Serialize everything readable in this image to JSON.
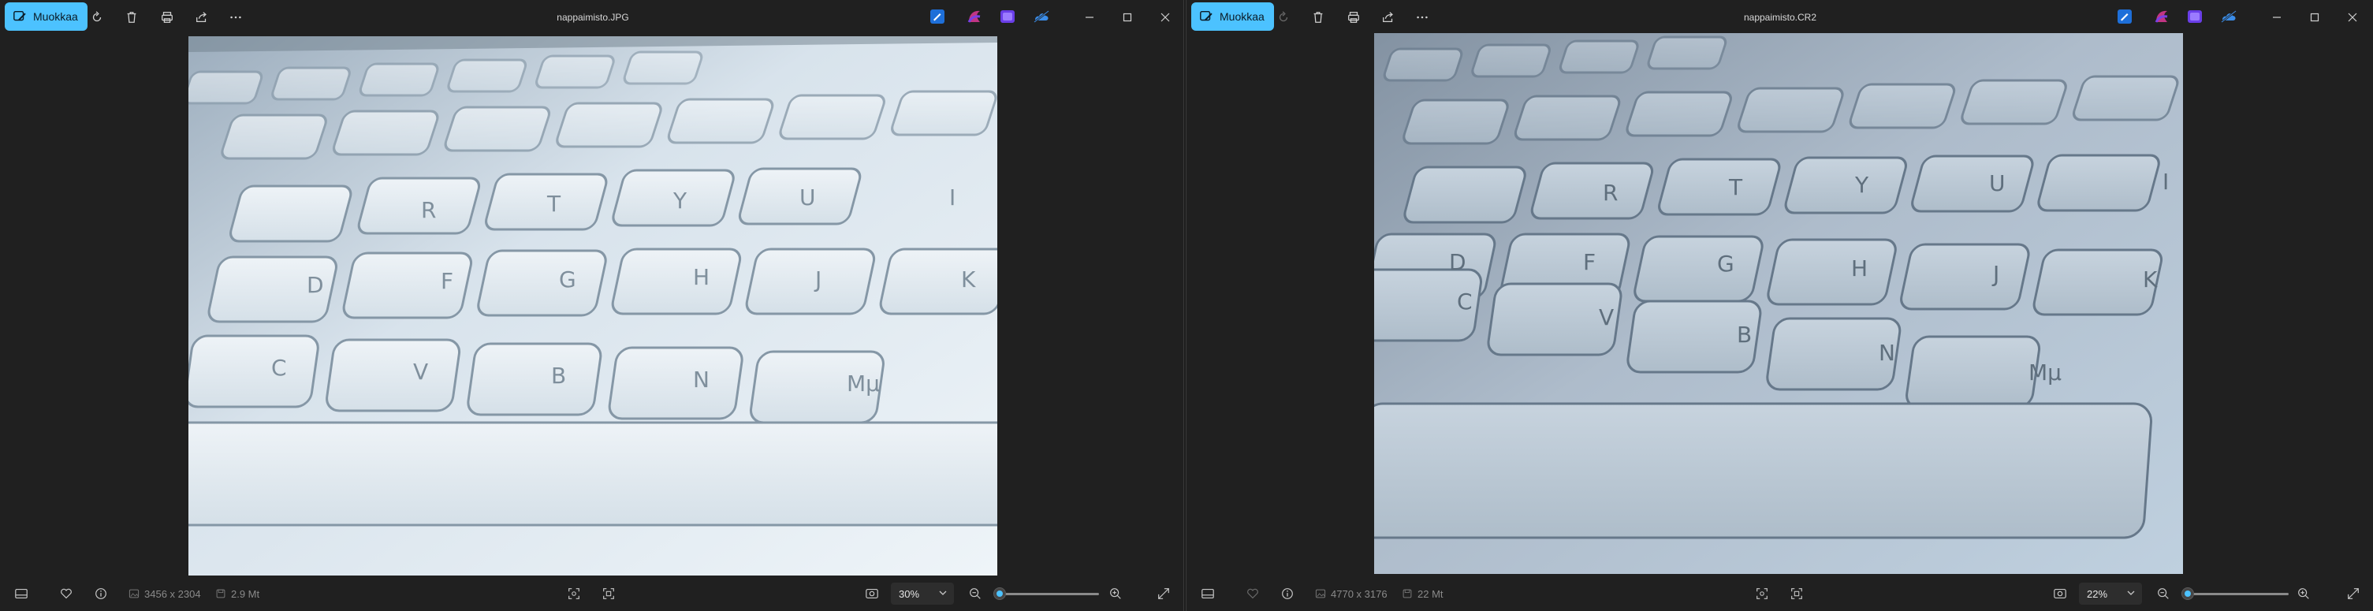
{
  "accent_color": "#4cc2ff",
  "windows": [
    {
      "edit_label": "Muokkaa",
      "filename": "nappaimisto.JPG",
      "dimensions": "3456 x 2304",
      "file_size": "2.9 Mt",
      "zoom": "30%",
      "zoom_fraction": 0.03
    },
    {
      "edit_label": "Muokkaa",
      "filename": "nappaimisto.CR2",
      "dimensions": "4770 x 3176",
      "file_size": "22 Mt",
      "zoom": "22%",
      "zoom_fraction": 0.0
    }
  ],
  "key_labels": {
    "row1": [
      "D",
      "F",
      "G",
      "H",
      "J",
      "K"
    ],
    "row2": [
      "C",
      "V",
      "B",
      "N",
      "Mμ"
    ],
    "row_top": [
      "R",
      "T",
      "Y",
      "U",
      "I"
    ]
  },
  "icons": {
    "toolbar": [
      "rotate-icon",
      "delete-icon",
      "print-icon",
      "share-icon",
      "more-icon"
    ],
    "apps": [
      "edit-app-icon",
      "clipchamp-icon",
      "photos-icon",
      "onedrive-icon"
    ],
    "bottom": [
      "filmstrip-icon",
      "favorite-icon",
      "info-icon",
      "fit-icon",
      "actual-size-icon",
      "zoom-out-icon",
      "zoom-in-icon",
      "fullscreen-icon"
    ]
  }
}
